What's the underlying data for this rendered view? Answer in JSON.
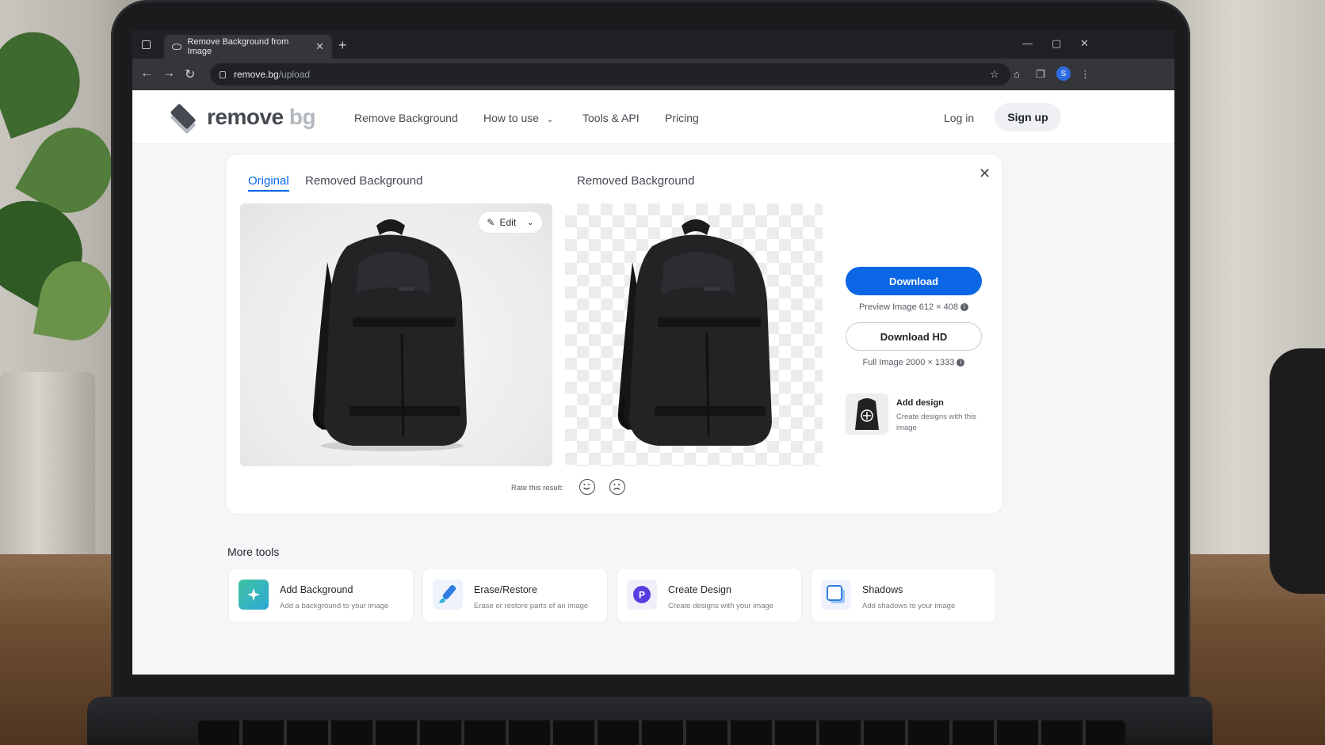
{
  "browser": {
    "tab_title": "Remove Background from Image",
    "url_host": "remove.bg",
    "url_path": "/upload",
    "profile_initial": "S"
  },
  "site": {
    "logo_main": "remove",
    "logo_accent": "bg",
    "nav": [
      "Remove Background",
      "How to use",
      "Tools & API",
      "Pricing"
    ],
    "login": "Log in",
    "signup": "Sign up"
  },
  "result": {
    "tab_original": "Original",
    "tab_removed": "Removed Background",
    "preview_heading": "Removed Background",
    "edit_label": "Edit",
    "download_label": "Download",
    "preview_info": "Preview Image 612 × 408",
    "download_hd_label": "Download HD",
    "full_info": "Full Image 2000 × 1333",
    "add_design_title": "Add design",
    "add_design_sub": "Create designs with this image",
    "rate_label": "Rate this result:"
  },
  "more_tools": {
    "title": "More tools",
    "items": [
      {
        "name": "Add Background",
        "desc": "Add a background to your image"
      },
      {
        "name": "Erase/Restore",
        "desc": "Erase or restore parts of an image"
      },
      {
        "name": "Create Design",
        "desc": "Create designs with your image"
      },
      {
        "name": "Shadows",
        "desc": "Add shadows to your image"
      }
    ]
  },
  "colors": {
    "accent": "#0a66e4",
    "text": "#454a52"
  }
}
